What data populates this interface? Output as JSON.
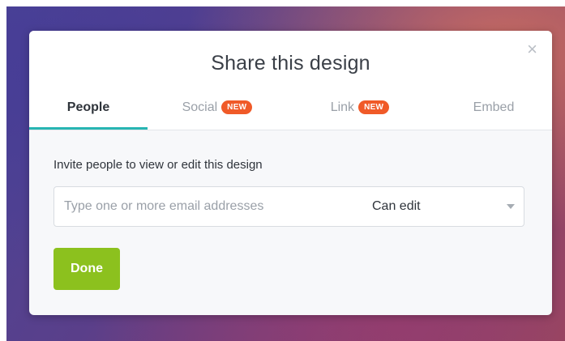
{
  "dialog": {
    "title": "Share this design",
    "close_glyph": "×",
    "close_icon": "close-icon"
  },
  "tabs": [
    {
      "label": "People",
      "active": true,
      "badge": ""
    },
    {
      "label": "Social",
      "active": false,
      "badge": "NEW"
    },
    {
      "label": "Link",
      "active": false,
      "badge": "NEW"
    },
    {
      "label": "Embed",
      "active": false,
      "badge": ""
    }
  ],
  "invite": {
    "label": "Invite people to view or edit this design",
    "email_placeholder": "Type one or more email addresses",
    "email_value": "",
    "permission_selected": "Can edit",
    "dropdown_icon": "chevron-down-icon"
  },
  "actions": {
    "done_label": "Done"
  },
  "colors": {
    "accent_tab_underline": "#27b5b2",
    "badge": "#f05a28",
    "done_button": "#8cc11e"
  }
}
